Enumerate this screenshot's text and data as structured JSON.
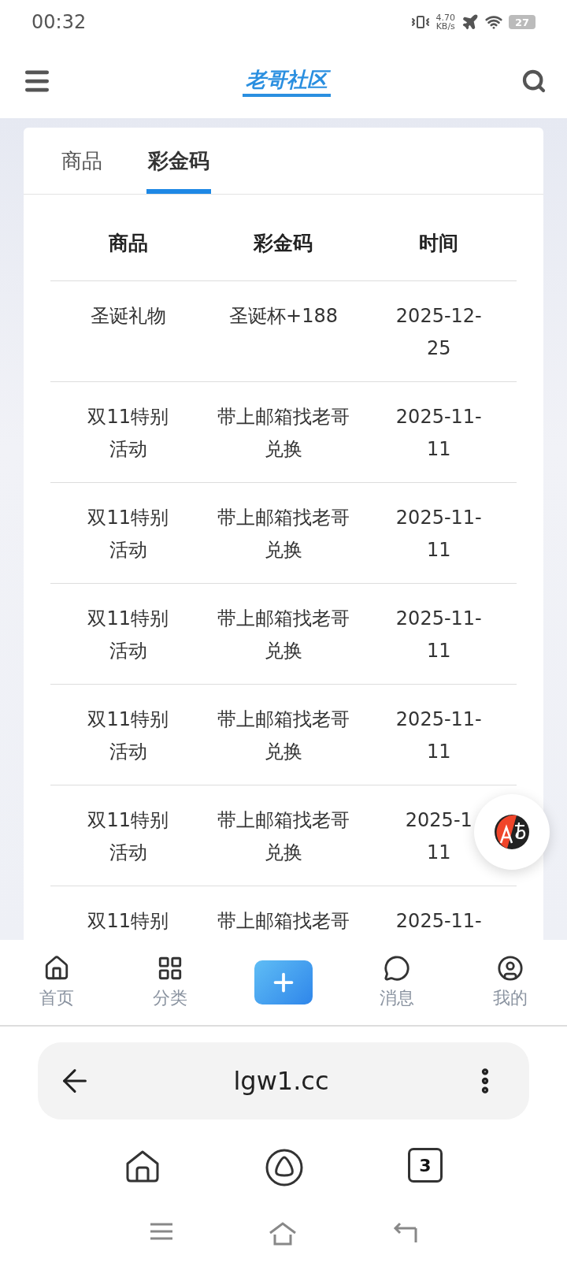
{
  "status_bar": {
    "time": "00:32",
    "speed_value": "4.70",
    "speed_unit": "KB/s",
    "battery": "27"
  },
  "header": {
    "logo": "老哥社区"
  },
  "tabs": [
    {
      "label": "商品",
      "selected": false
    },
    {
      "label": "彩金码",
      "selected": true
    }
  ],
  "table": {
    "columns": [
      "商品",
      "彩金码",
      "时间"
    ],
    "rows": [
      {
        "cells": [
          [
            "圣诞礼物"
          ],
          [
            "圣诞杯+188"
          ],
          [
            "2025-12-",
            "25"
          ]
        ]
      },
      {
        "cells": [
          [
            "双11特别",
            "活动"
          ],
          [
            "带上邮箱找老哥",
            "兑换"
          ],
          [
            "2025-11-",
            "11"
          ]
        ]
      },
      {
        "cells": [
          [
            "双11特别",
            "活动"
          ],
          [
            "带上邮箱找老哥",
            "兑换"
          ],
          [
            "2025-11-",
            "11"
          ]
        ]
      },
      {
        "cells": [
          [
            "双11特别",
            "活动"
          ],
          [
            "带上邮箱找老哥",
            "兑换"
          ],
          [
            "2025-11-",
            "11"
          ]
        ]
      },
      {
        "cells": [
          [
            "双11特别",
            "活动"
          ],
          [
            "带上邮箱找老哥",
            "兑换"
          ],
          [
            "2025-11-",
            "11"
          ]
        ]
      },
      {
        "cells": [
          [
            "双11特别",
            "活动"
          ],
          [
            "带上邮箱找老哥",
            "兑换"
          ],
          [
            "2025-1",
            "11"
          ]
        ]
      },
      {
        "cells": [
          [
            "双11特别"
          ],
          [
            "带上邮箱找老哥"
          ],
          [
            "2025-11-"
          ]
        ]
      }
    ]
  },
  "bottom_nav": [
    {
      "kind": "home",
      "label": "首页"
    },
    {
      "kind": "grid",
      "label": "分类"
    },
    {
      "kind": "add"
    },
    {
      "kind": "message",
      "label": "消息"
    },
    {
      "kind": "profile",
      "label": "我的"
    }
  ],
  "browser": {
    "url": "lgw1.cc",
    "tab_count": "3"
  }
}
